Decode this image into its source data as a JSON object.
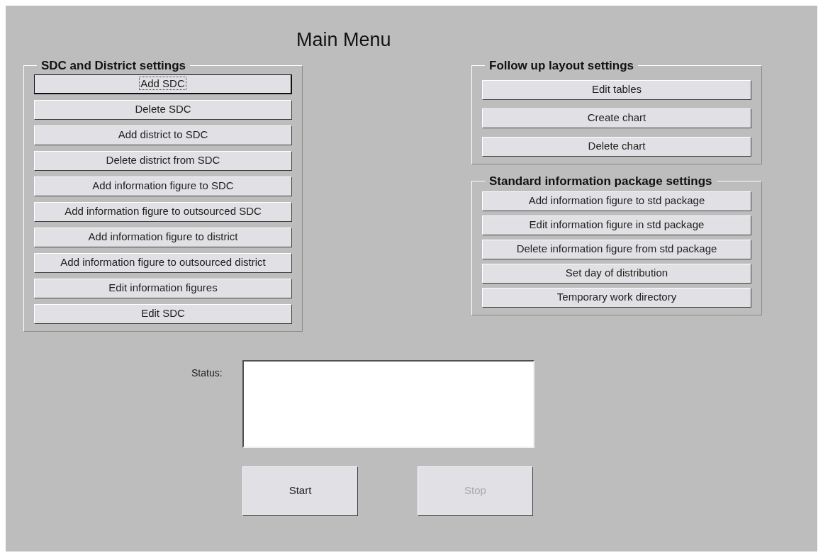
{
  "title": "Main Menu",
  "groups": [
    {
      "title": "SDC and District settings",
      "buttons": [
        {
          "label": "Add SDC",
          "focused": true
        },
        {
          "label": "Delete SDC",
          "focused": false
        },
        {
          "label": "Add district to SDC",
          "focused": false
        },
        {
          "label": "Delete district from SDC",
          "focused": false
        },
        {
          "label": "Add information figure to SDC",
          "focused": false
        },
        {
          "label": "Add information figure to outsourced SDC",
          "focused": false
        },
        {
          "label": "Add information figure to district",
          "focused": false
        },
        {
          "label": "Add information figure to outsourced district",
          "focused": false
        },
        {
          "label": "Edit information figures",
          "focused": false
        },
        {
          "label": "Edit SDC",
          "focused": false
        }
      ]
    },
    {
      "title": "Follow up layout settings",
      "buttons": [
        {
          "label": "Edit tables",
          "focused": false
        },
        {
          "label": "Create chart",
          "focused": false
        },
        {
          "label": "Delete chart",
          "focused": false
        }
      ]
    },
    {
      "title": "Standard information package settings",
      "buttons": [
        {
          "label": "Add information figure to std package",
          "focused": false
        },
        {
          "label": "Edit information figure in std package",
          "focused": false
        },
        {
          "label": "Delete information figure from std package",
          "focused": false
        },
        {
          "label": "Set day of distribution",
          "focused": false
        },
        {
          "label": "Temporary work directory",
          "focused": false
        }
      ]
    }
  ],
  "status": {
    "label": "Status:"
  },
  "actions": [
    {
      "label": "Start",
      "disabled": false
    },
    {
      "label": "Stop",
      "disabled": true
    }
  ]
}
